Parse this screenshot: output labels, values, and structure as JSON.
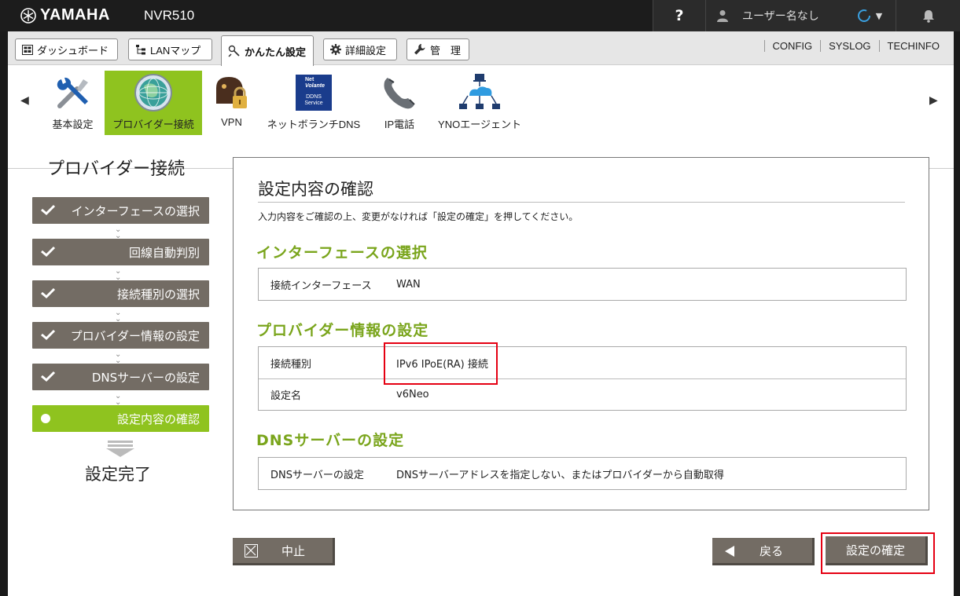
{
  "header": {
    "brand": "YAMAHA",
    "model": "NVR510",
    "help": "?",
    "user_label": "ユーザー名なし"
  },
  "tabs": [
    {
      "label": "ダッシュボード",
      "icon": "dashboard-icon"
    },
    {
      "label": "LANマップ",
      "icon": "lan-map-icon"
    },
    {
      "label": "かんたん設定",
      "icon": "easy-setup-icon",
      "active": true
    },
    {
      "label": "詳細設定",
      "icon": "gear-icon"
    },
    {
      "label": "管　理",
      "icon": "wrench-icon"
    }
  ],
  "toplinks": [
    "CONFIG",
    "SYSLOG",
    "TECHINFO"
  ],
  "wizards": [
    {
      "label": "基本設定",
      "icon": "tools-icon"
    },
    {
      "label": "プロバイダー接続",
      "icon": "globe-icon",
      "active": true
    },
    {
      "label": "VPN",
      "icon": "vpn-lock-icon"
    },
    {
      "label": "ネットボランチDNS",
      "icon": "ddns-icon",
      "icon_text": [
        "Net",
        "Volante",
        "DDNS",
        "Service"
      ]
    },
    {
      "label": "IP電話",
      "icon": "phone-icon"
    },
    {
      "label": "YNOエージェント",
      "icon": "network-icon"
    }
  ],
  "left": {
    "title": "プロバイダー接続",
    "steps": [
      "インターフェースの選択",
      "回線自動判別",
      "接続種別の選択",
      "プロバイダー情報の設定",
      "DNSサーバーの設定",
      "設定内容の確認"
    ],
    "done": "設定完了"
  },
  "panel": {
    "title": "設定内容の確認",
    "description": "入力内容をご確認の上、変更がなければ「設定の確定」を押してください。",
    "sections": [
      {
        "title": "インターフェースの選択",
        "rows": [
          {
            "key": "接続インターフェース",
            "value": "WAN"
          }
        ]
      },
      {
        "title": "プロバイダー情報の設定",
        "rows": [
          {
            "key": "接続種別",
            "value": "IPv6 IPoE(RA) 接続"
          },
          {
            "key": "設定名",
            "value": "v6Neo"
          }
        ]
      },
      {
        "title": "DNSサーバーの設定",
        "rows": [
          {
            "key": "DNSサーバーの設定",
            "value": "DNSサーバーアドレスを指定しない、またはプロバイダーから自動取得"
          }
        ]
      }
    ]
  },
  "buttons": {
    "cancel": "中止",
    "back": "戻る",
    "confirm": "設定の確定"
  },
  "colors": {
    "accent_green": "#8fc31f",
    "section_green": "#7aa51c",
    "button_gray": "#736c64",
    "highlight_red": "#e50012"
  }
}
